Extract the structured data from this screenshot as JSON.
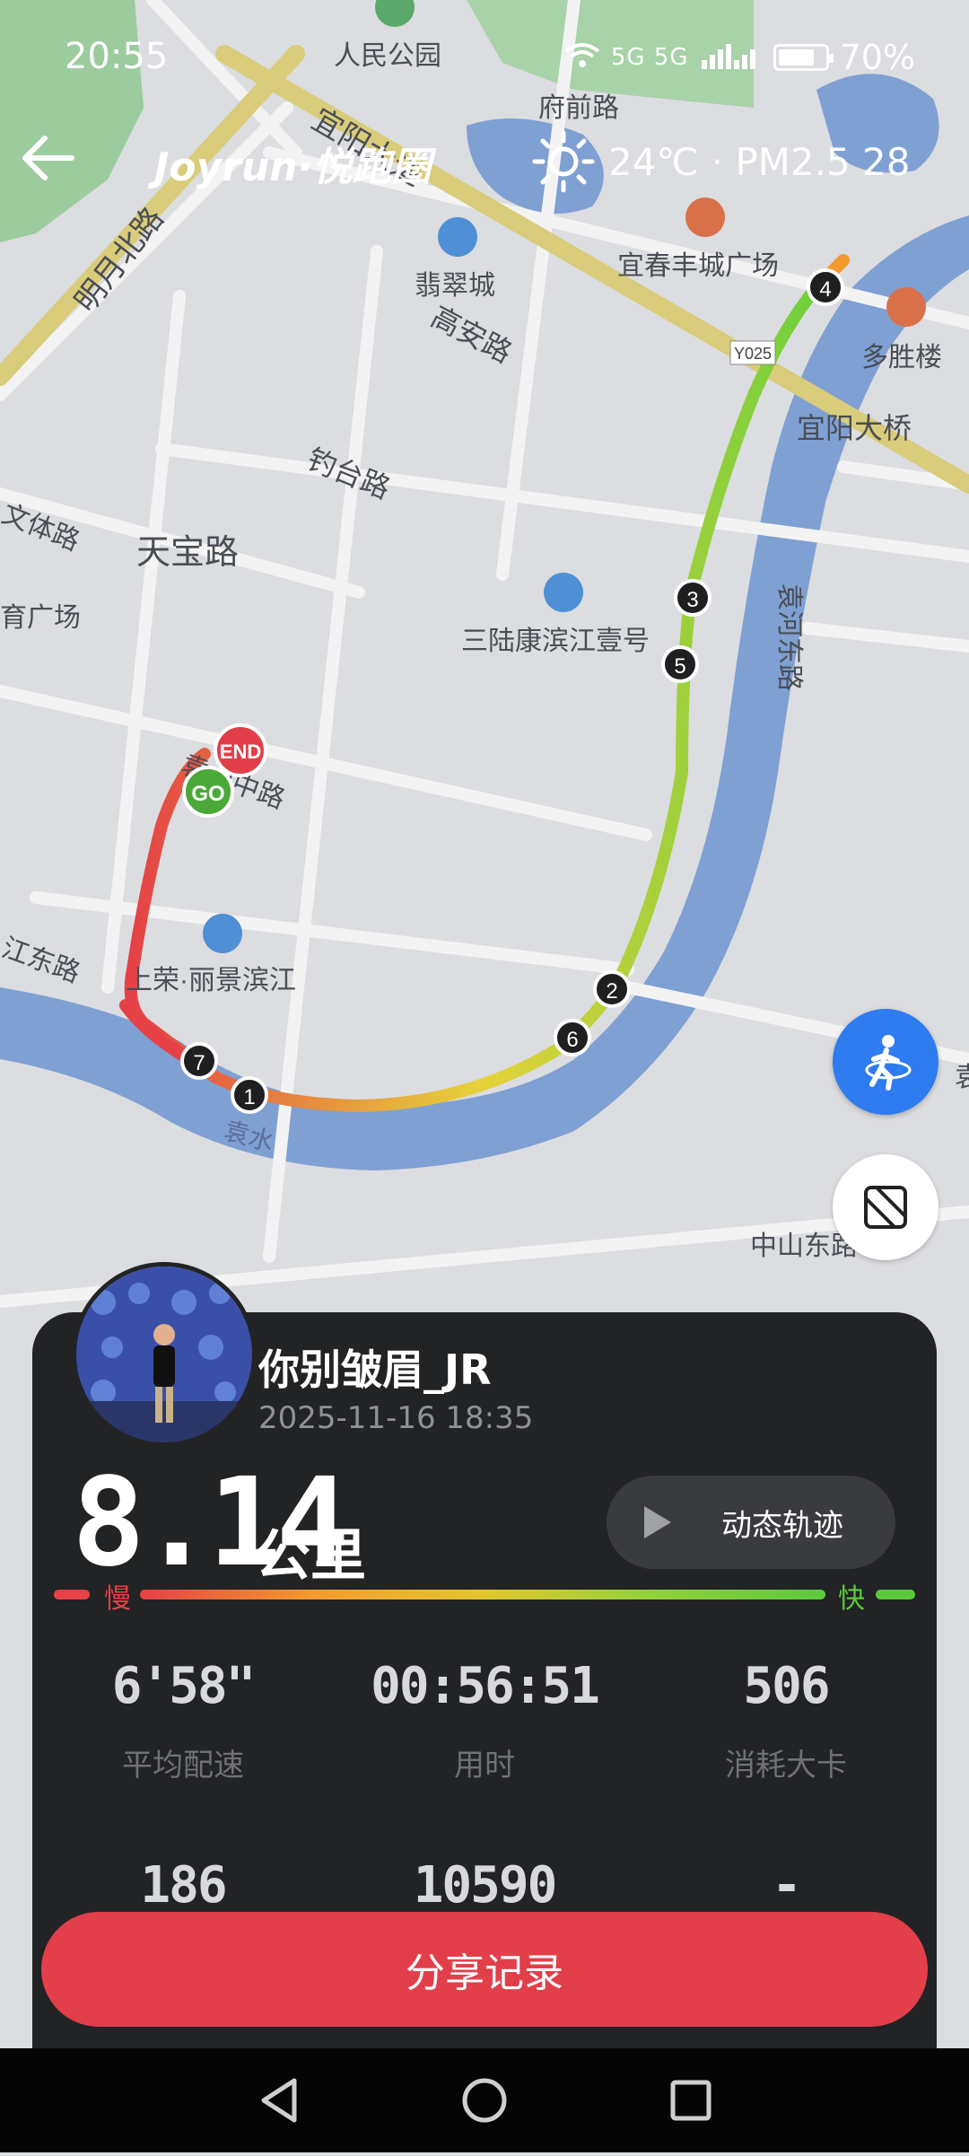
{
  "status_bar": {
    "time": "20:55",
    "network": "5G 5G",
    "battery": "70%"
  },
  "header": {
    "brand": "Joyrun·悦跑圈",
    "temperature": "24℃",
    "air_quality": "· PM2.5 28"
  },
  "map": {
    "labels": {
      "park": "人民公园",
      "fuqian": "府前路",
      "yiyang_dao": "宜阳大道",
      "mingyue": "明月北路",
      "feicui": "翡翠城",
      "gaoan": "高安路",
      "fengcheng": "宜春丰城广场",
      "duosheng": "多胜楼",
      "yiyang_bridge": "宜阳大桥",
      "diaotai": "钓台路",
      "wenti": "文体路",
      "tianbao": "天宝路",
      "tiyu": "育广场",
      "sanlu": "三陆康滨江壹号",
      "yuanhe": "袁河东路",
      "yuanshan": "袁山中路",
      "rongli": "上荣·丽景滨江",
      "jiangdong": "江东路",
      "yuanshui": "袁水",
      "zhongshan": "中山东路",
      "road_code": "Y025",
      "yuan_suffix": "袁"
    },
    "markers": {
      "end": "END",
      "go": "GO",
      "km": [
        "1",
        "2",
        "3",
        "4",
        "5",
        "6",
        "7"
      ]
    }
  },
  "card": {
    "user_name": "你别皱眉_JR",
    "date": "2025-11-16 18:35",
    "distance": "8.14",
    "distance_unit": "公里",
    "replay_label": "动态轨迹",
    "slow_label": "慢",
    "fast_label": "快",
    "stats": [
      {
        "value": "6'58\"",
        "label": "平均配速"
      },
      {
        "value": "00:56:51",
        "label": "用时"
      },
      {
        "value": "506",
        "label": "消耗大卡"
      },
      {
        "value": "186",
        "label": ""
      },
      {
        "value": "10590",
        "label": ""
      },
      {
        "value": "-",
        "label": ""
      }
    ],
    "share_label": "分享记录"
  },
  "colors": {
    "accent": "#e23f4b",
    "run_blue": "#2f7bf0",
    "card_bg": "#222325"
  }
}
